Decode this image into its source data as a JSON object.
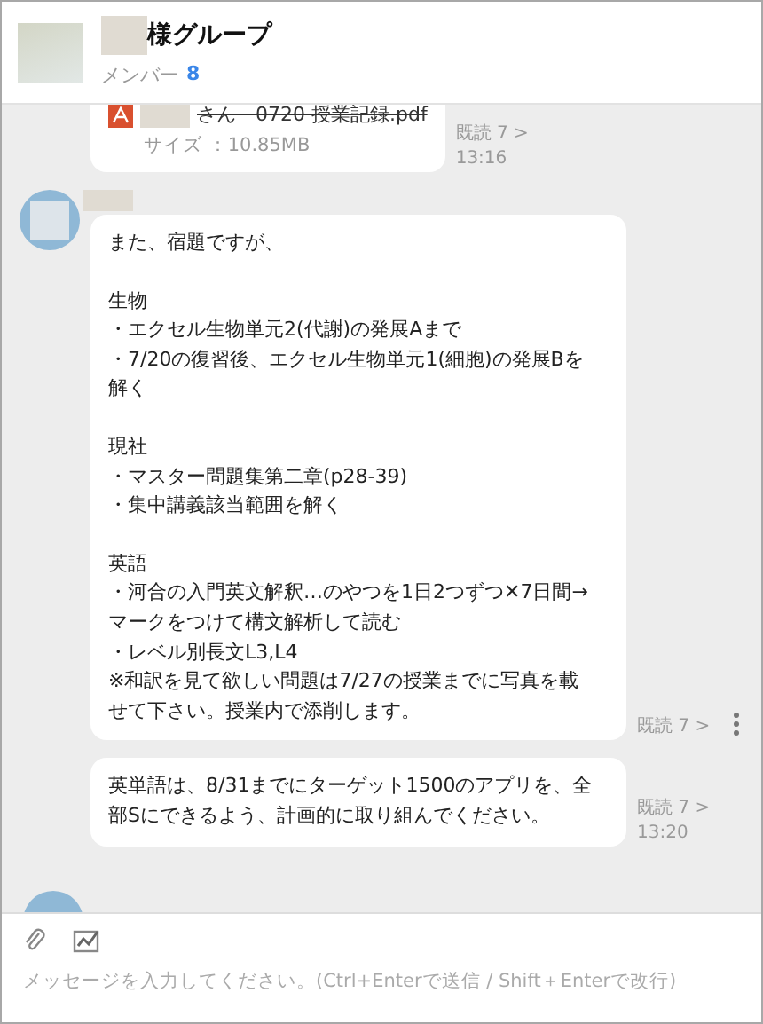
{
  "header": {
    "title": "様グループ",
    "members_label": "メンバー",
    "members_count": "8"
  },
  "messages": [
    {
      "kind": "file",
      "file_name": "さん　0720 授業記録.pdf",
      "struck": true,
      "size": "サイズ ：10.85MB",
      "read": "既読 7 >",
      "time": "13:16",
      "menu": false
    },
    {
      "kind": "text",
      "avatar": true,
      "paragraphs": [
        [
          "また、宿題ですが、"
        ],
        [
          "生物",
          "・エクセル生物単元2(代謝)の発展Aまで",
          "・7/20の復習後、エクセル生物単元1(細胞)の発展Bを解く"
        ],
        [
          "現社",
          "・マスター問題集第二章(p28-39)",
          "・集中講義該当範囲を解く"
        ],
        [
          "英語",
          "・河合の入門英文解釈…のやつを1日2つずつ✕7日間→マークをつけて構文解析して読む",
          "・レベル別長文L3,L4",
          "※和訳を見て欲しい問題は7/27の授業までに写真を載せて下さい。授業内で添削します。"
        ]
      ],
      "read": "既読 7 >",
      "menu": true
    },
    {
      "kind": "text",
      "avatar": false,
      "paragraphs": [
        [
          "英単語は、8/31までにターゲット1500のアプリを、全部Sにできるよう、計画的に取り組んでください。"
        ]
      ],
      "read": "既読 7 >",
      "time": "13:20",
      "menu": false
    }
  ],
  "composer": {
    "placeholder": "メッセージを入力してください。(Ctrl+Enterで送信 / Shift＋Enterで改行)"
  }
}
